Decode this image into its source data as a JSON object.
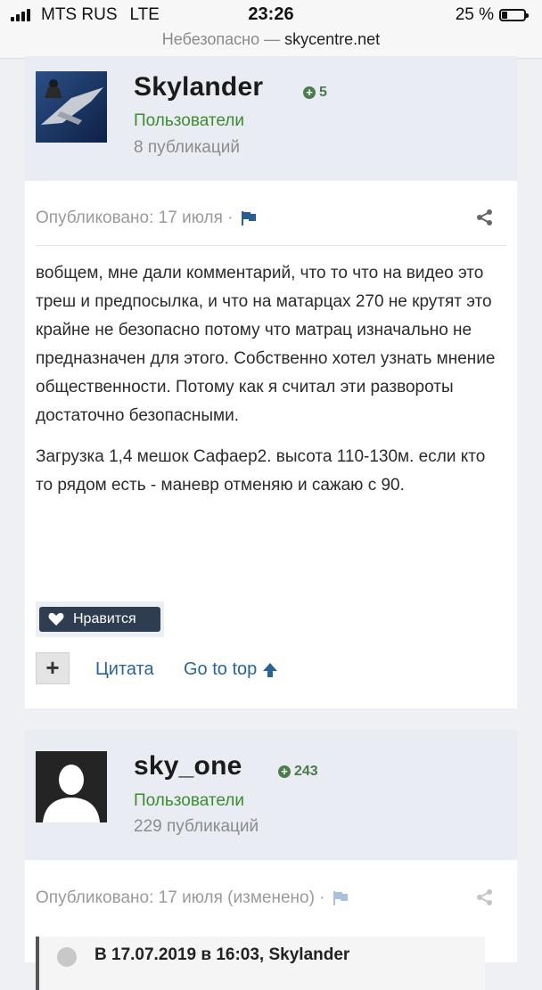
{
  "status": {
    "carrier": "MTS RUS",
    "network": "LTE",
    "time": "23:26",
    "battery_text": "25 %",
    "battery_level": 0.25
  },
  "url": {
    "insecure_label": "Небезопасно —",
    "host": "skycentre.net"
  },
  "posts": [
    {
      "author": "Skylander",
      "reputation": "5",
      "group": "Пользователи",
      "post_count": "8 публикаций",
      "published": "Опубликовано: 17 июля ·",
      "paragraphs": [
        "вобщем, мне дали комментарий, что то что на видео это треш и предпосылка, и что на матарцах 270 не крутят это крайне не безопасно потому что матрац изначально не предназначен для этого. Собственно хотел узнать мнение общественности. Потому как я считал эти развороты достаточно безопасными.",
        "Загрузка 1,4 мешок Сафаер2. высота 110-130м. если кто то рядом есть - маневр отменяю и сажаю с 90."
      ],
      "like_label": "Нравится",
      "quote_label": "Цитата",
      "go_top_label": "Go to top",
      "plus_label": "+"
    },
    {
      "author": "sky_one",
      "reputation": "243",
      "group": "Пользователи",
      "post_count": "229 публикаций",
      "published": "Опубликовано: 17 июля (изменено) ·",
      "quote_header": "В 17.07.2019 в 16:03, Skylander"
    }
  ],
  "colors": {
    "group_green": "#3d8c2f",
    "link_blue": "#2a6496",
    "header_bg": "#e9ecf2",
    "like_bg": "#2e3d4f"
  },
  "icons": {
    "reputation": "plus-circle-icon",
    "flag": "flag-icon",
    "share": "share-icon",
    "like": "heart-icon",
    "go_top": "arrow-up-icon"
  }
}
